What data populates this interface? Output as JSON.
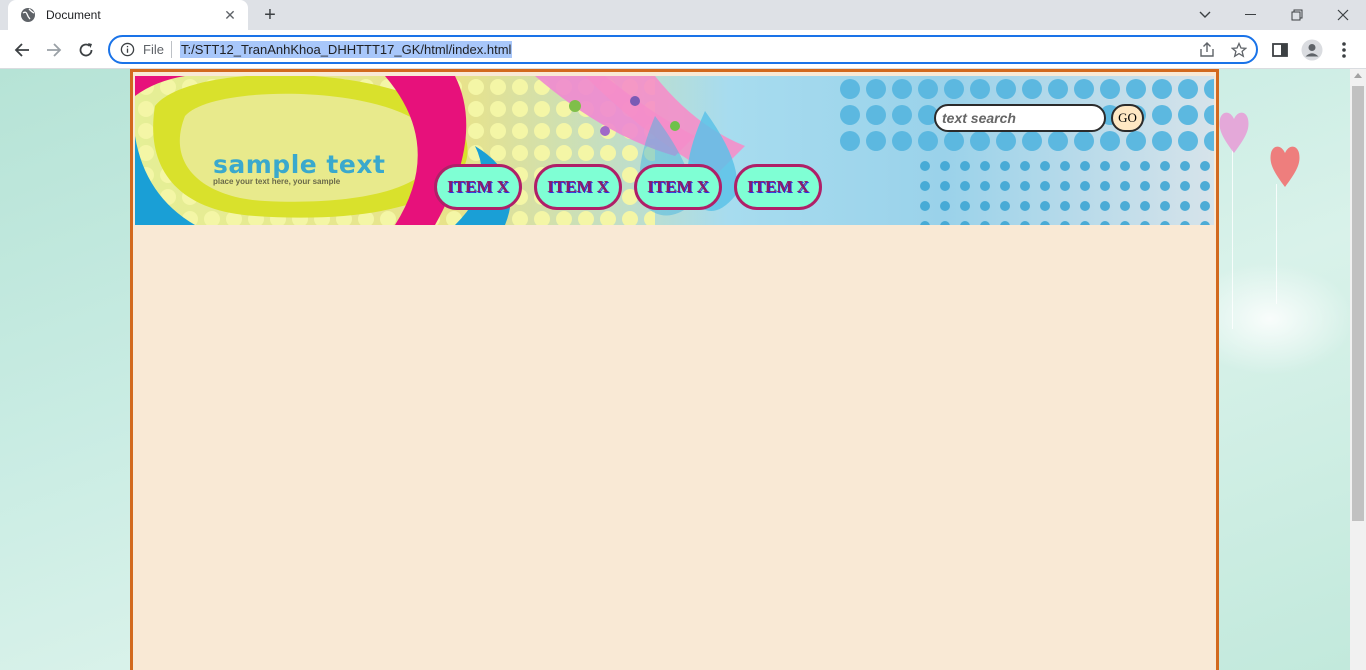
{
  "browser": {
    "tab_title": "Document",
    "omnibox_scheme": "File",
    "url": "T:/STT12_TranAnhKhoa_DHHTTT17_GK/html/index.html"
  },
  "page": {
    "banner": {
      "sample_text": "sample text",
      "sample_subtext": "place your text here, your sample"
    },
    "nav_items": [
      "ITEM X",
      "ITEM X",
      "ITEM X",
      "ITEM X"
    ],
    "search": {
      "placeholder": "text search",
      "go_label": "GO"
    },
    "colors": {
      "frame_border": "#d2691e",
      "content_bg": "#f9e9d5",
      "nav_fill": "#7fffd4",
      "nav_border": "#b01f68"
    }
  }
}
